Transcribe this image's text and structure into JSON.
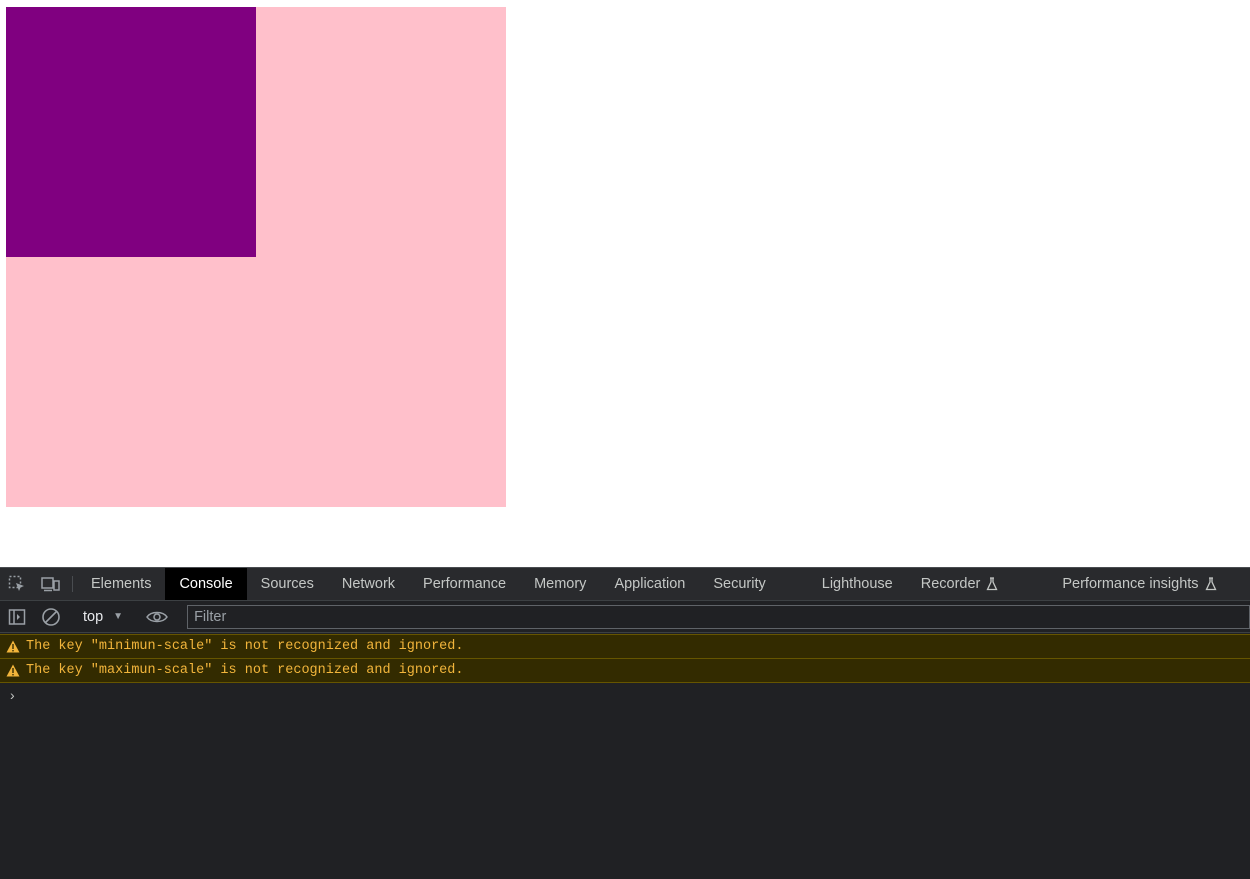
{
  "page": {
    "outer_box_color": "#ffc0cb",
    "inner_box_color": "#800080"
  },
  "devtools": {
    "tabs": [
      {
        "label": "Elements",
        "active": false
      },
      {
        "label": "Console",
        "active": true
      },
      {
        "label": "Sources",
        "active": false
      },
      {
        "label": "Network",
        "active": false
      },
      {
        "label": "Performance",
        "active": false
      },
      {
        "label": "Memory",
        "active": false
      },
      {
        "label": "Application",
        "active": false
      },
      {
        "label": "Security",
        "active": false
      },
      {
        "label": "Lighthouse",
        "active": false
      },
      {
        "label": "Recorder",
        "active": false,
        "icon": "flask-icon"
      },
      {
        "label": "Performance insights",
        "active": false,
        "icon": "flask-icon"
      }
    ],
    "toolbar": {
      "context": "top",
      "filter_placeholder": "Filter"
    },
    "messages": [
      {
        "level": "warning",
        "text": "The key \"minimun-scale\" is not recognized and ignored."
      },
      {
        "level": "warning",
        "text": "The key \"maximun-scale\" is not recognized and ignored."
      }
    ],
    "prompt_symbol": "›",
    "colors": {
      "panel_bg": "#202124",
      "active_tab_bg": "#000000",
      "warning_bg": "#332b00",
      "warning_text": "#f2b53b"
    }
  }
}
